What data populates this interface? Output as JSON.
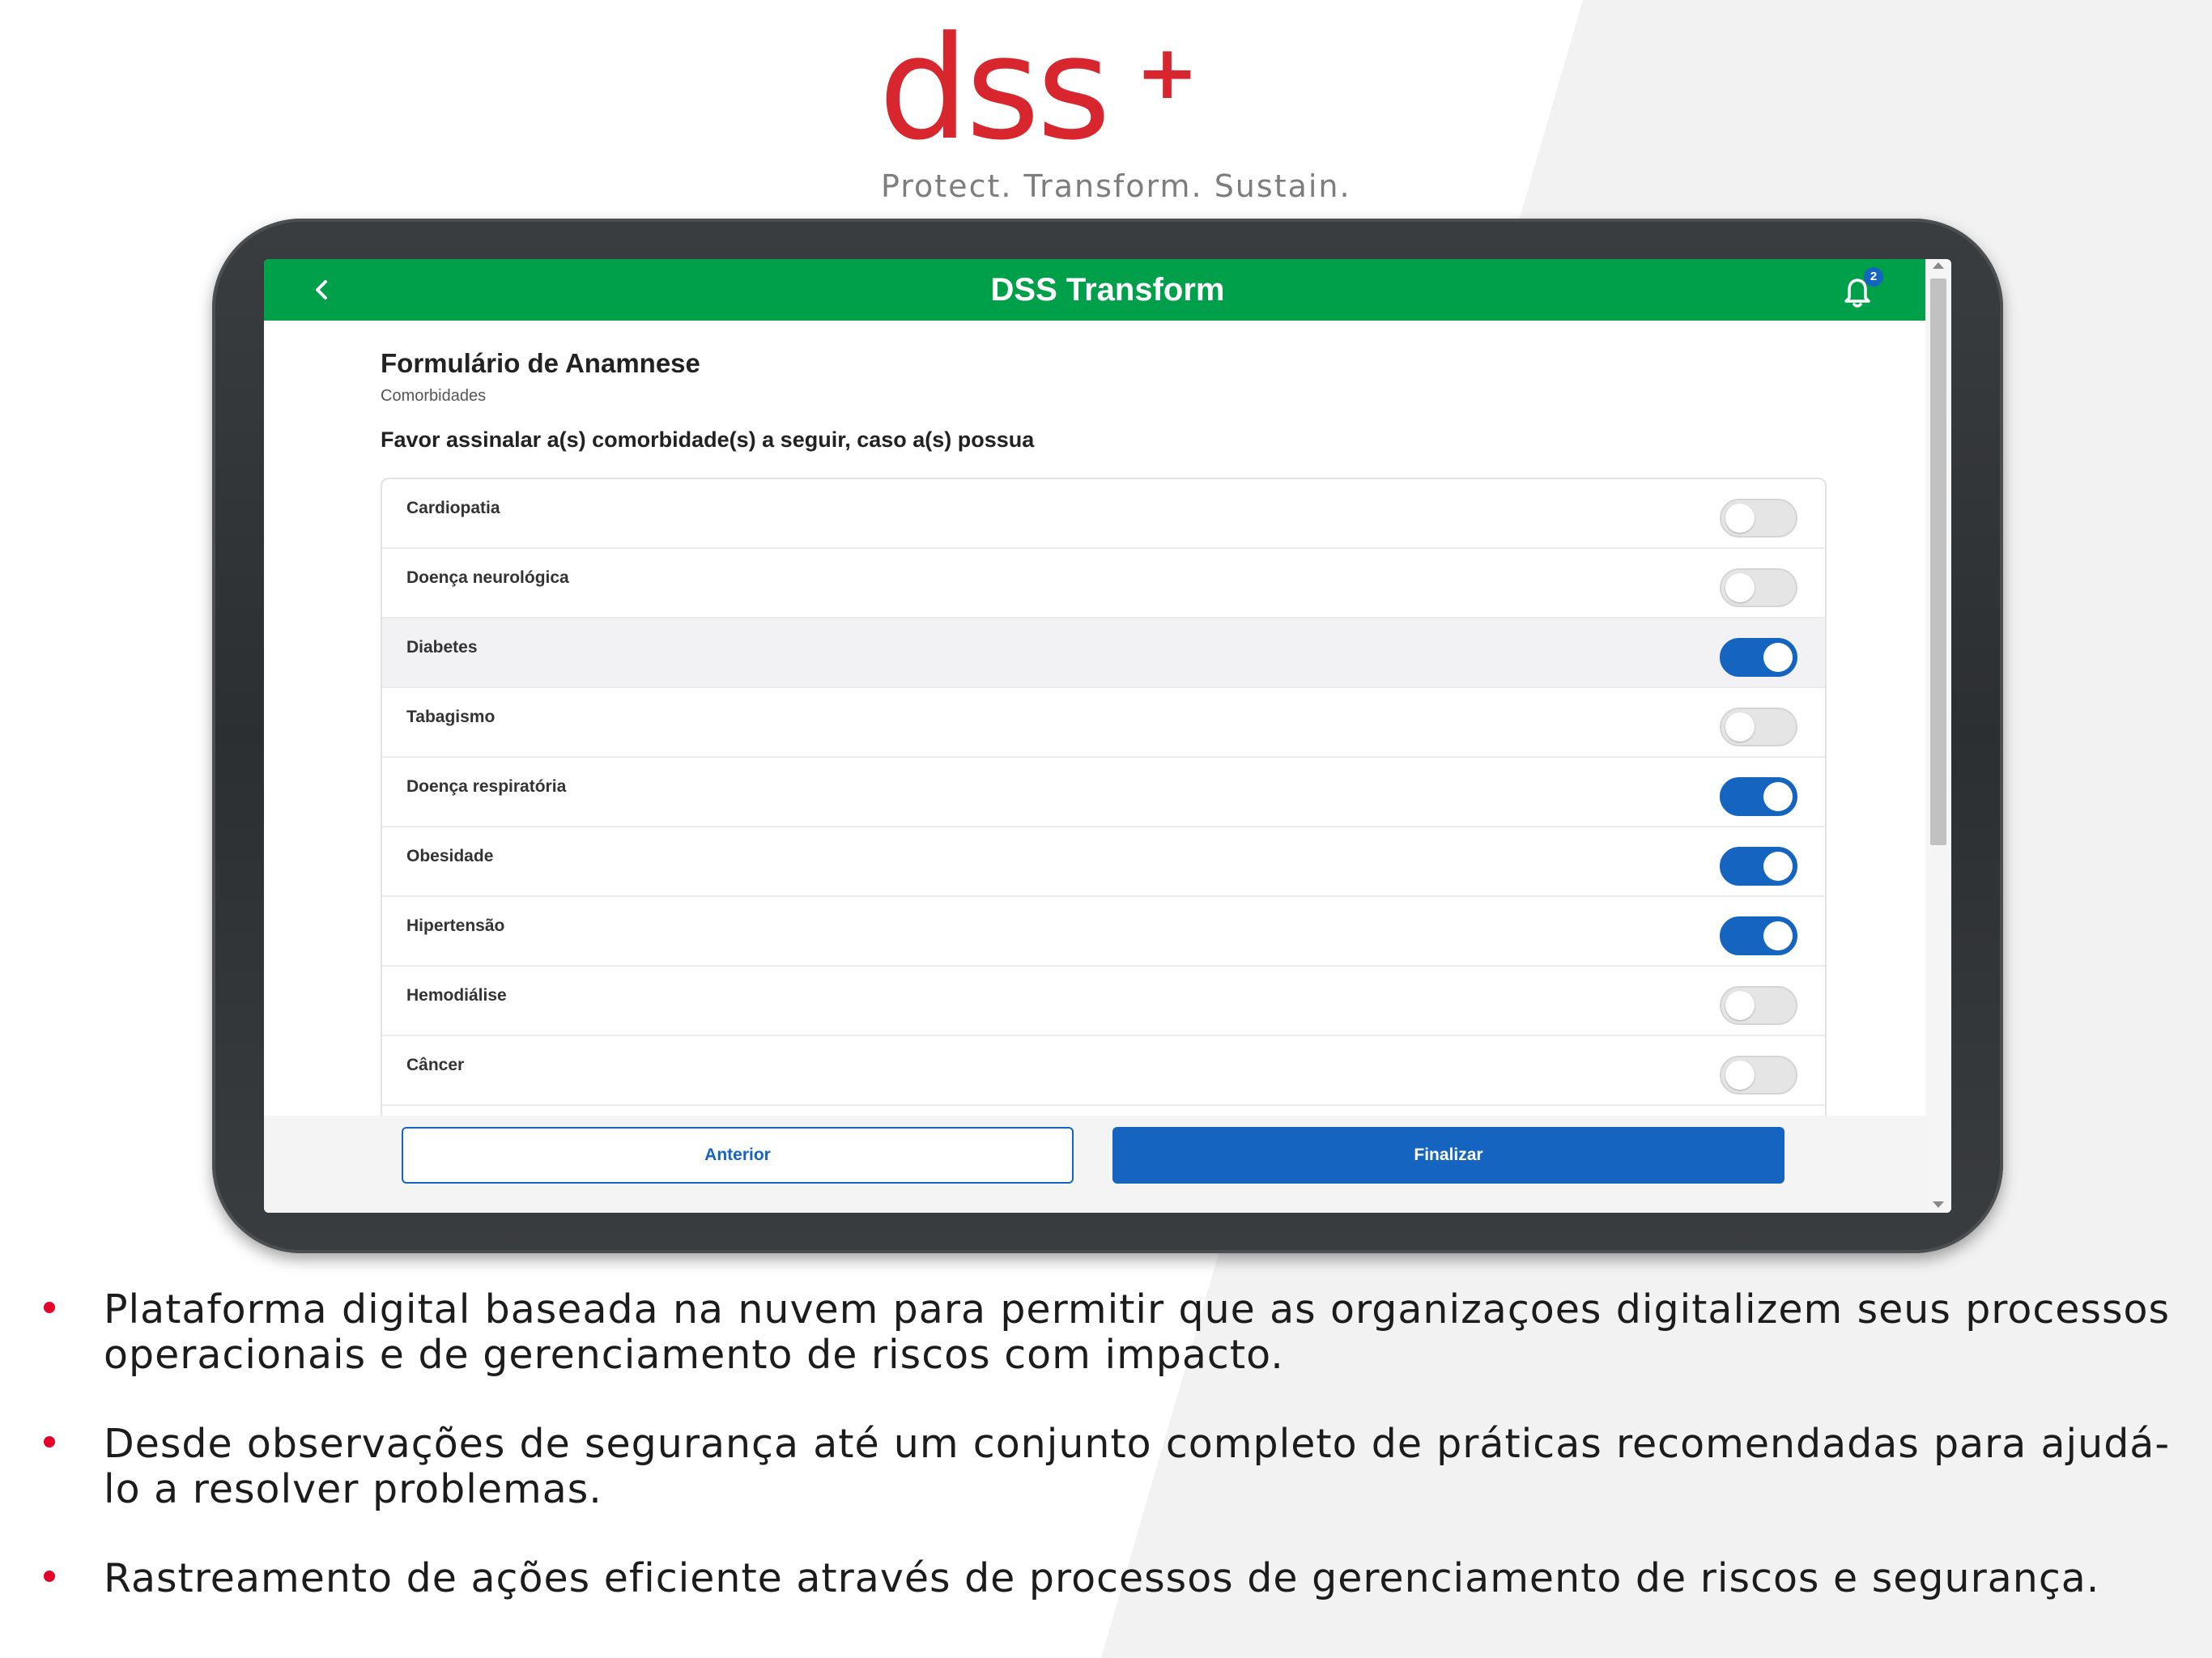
{
  "branding": {
    "logo_text": "dss",
    "logo_plus": "+",
    "tagline": "Protect. Transform. Sustain.",
    "brand_color": "#d7262e"
  },
  "app": {
    "title": "DSS Transform",
    "back_icon": "chevron-left-icon",
    "notification_icon": "bell-icon",
    "notification_count": "2",
    "appbar_color": "#00a04a",
    "accent_color": "#1565c0"
  },
  "form": {
    "title": "Formulário de Anamnese",
    "subtitle": "Comorbidades",
    "question": "Favor assinalar a(s) comorbidade(s) a seguir, caso a(s) possua",
    "items": [
      {
        "label": "Cardiopatia",
        "checked": false
      },
      {
        "label": "Doença neurológica",
        "checked": false
      },
      {
        "label": "Diabetes",
        "checked": true
      },
      {
        "label": "Tabagismo",
        "checked": false
      },
      {
        "label": "Doença respiratória",
        "checked": true
      },
      {
        "label": "Obesidade",
        "checked": true
      },
      {
        "label": "Hipertensão",
        "checked": true
      },
      {
        "label": "Hemodiálise",
        "checked": false
      },
      {
        "label": "Câncer",
        "checked": false
      }
    ]
  },
  "footer": {
    "previous_label": "Anterior",
    "finish_label": "Finalizar"
  },
  "bullets": [
    "Plataforma digital baseada na nuvem para permitir que as organizaçoes digitalizem seus processos operacionais e de gerenciamento de riscos com impacto.",
    "Desde observações de segurança até um conjunto completo de práticas recomendadas para ajudá-lo a resolver problemas.",
    "Rastreamento de ações eficiente através de processos de gerenciamento de riscos e segurança."
  ]
}
